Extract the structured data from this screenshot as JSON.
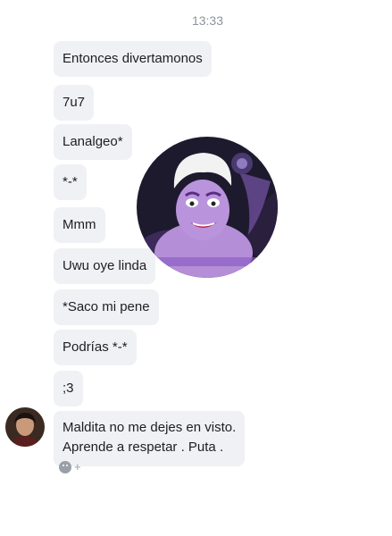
{
  "conversation": {
    "timestamp": "13:33",
    "messages": [
      {
        "text": "Entonces divertamonos"
      },
      {
        "text": "7u7"
      },
      {
        "text": "Lanalgeo*"
      },
      {
        "text": "*-*"
      },
      {
        "text": "Mmm"
      },
      {
        "text": "Uwu oye linda"
      },
      {
        "text": "*Saco mi pene"
      },
      {
        "text": "Podrías *-*"
      },
      {
        "text": ";3"
      }
    ],
    "last_message": {
      "line1": "Maldita no me dejes en visto.",
      "line2": "Aprende a respetar . Puta ."
    },
    "reaction_add": "+"
  },
  "icons": {
    "sticker": "cartoon-sea-witch-sticker",
    "avatar": "user-avatar",
    "reaction": "smile-icon"
  },
  "colors": {
    "bubble": "#f0f1f4",
    "timestamp": "#8d949e"
  }
}
